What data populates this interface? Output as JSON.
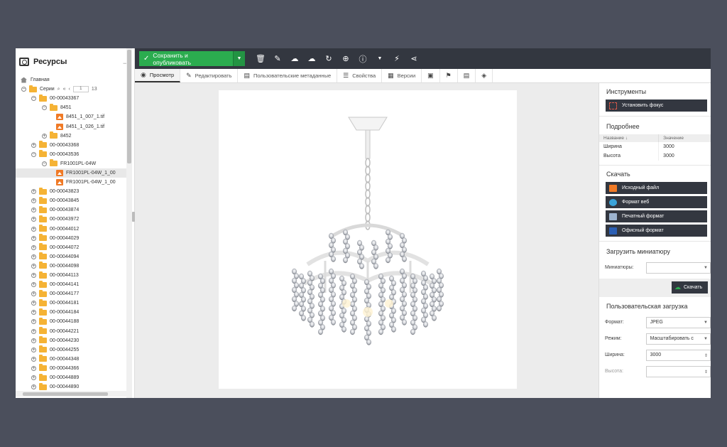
{
  "sidebar": {
    "title": "Ресурсы",
    "home": "Главная",
    "series": "Серии",
    "page_current": "1",
    "page_total": "13",
    "tree": [
      {
        "label": "00-00043367",
        "level": 1,
        "type": "folder",
        "toggle": "−"
      },
      {
        "label": "8451",
        "level": 2,
        "type": "folder",
        "toggle": "−"
      },
      {
        "label": "8451_1_007_1.tif",
        "level": 3,
        "type": "image"
      },
      {
        "label": "8451_1_026_1.tif",
        "level": 3,
        "type": "image"
      },
      {
        "label": "8452",
        "level": 2,
        "type": "folder",
        "toggle": "+"
      },
      {
        "label": "00-00043368",
        "level": 1,
        "type": "folder",
        "toggle": "+"
      },
      {
        "label": "00-00043536",
        "level": 1,
        "type": "folder",
        "toggle": "−"
      },
      {
        "label": "FR1001PL-04W",
        "level": 2,
        "type": "folder",
        "toggle": "−"
      },
      {
        "label": "FR1001PL-04W_1_00",
        "level": 3,
        "type": "image",
        "selected": true
      },
      {
        "label": "FR1001PL-04W_1_00",
        "level": 3,
        "type": "image"
      },
      {
        "label": "00-00043823",
        "level": 1,
        "type": "folder",
        "toggle": "+"
      },
      {
        "label": "00-00043845",
        "level": 1,
        "type": "folder",
        "toggle": "+"
      },
      {
        "label": "00-00043874",
        "level": 1,
        "type": "folder",
        "toggle": "+"
      },
      {
        "label": "00-00043972",
        "level": 1,
        "type": "folder",
        "toggle": "+"
      },
      {
        "label": "00-00044012",
        "level": 1,
        "type": "folder",
        "toggle": "+"
      },
      {
        "label": "00-00044029",
        "level": 1,
        "type": "folder",
        "toggle": "+"
      },
      {
        "label": "00-00044072",
        "level": 1,
        "type": "folder",
        "toggle": "+"
      },
      {
        "label": "00-00044094",
        "level": 1,
        "type": "folder",
        "toggle": "+"
      },
      {
        "label": "00-00044098",
        "level": 1,
        "type": "folder",
        "toggle": "+"
      },
      {
        "label": "00-00044113",
        "level": 1,
        "type": "folder",
        "toggle": "+"
      },
      {
        "label": "00-00044141",
        "level": 1,
        "type": "folder",
        "toggle": "+"
      },
      {
        "label": "00-00044177",
        "level": 1,
        "type": "folder",
        "toggle": "+"
      },
      {
        "label": "00-00044181",
        "level": 1,
        "type": "folder",
        "toggle": "+"
      },
      {
        "label": "00-00044184",
        "level": 1,
        "type": "folder",
        "toggle": "+"
      },
      {
        "label": "00-00044188",
        "level": 1,
        "type": "folder",
        "toggle": "+"
      },
      {
        "label": "00-00044221",
        "level": 1,
        "type": "folder",
        "toggle": "+"
      },
      {
        "label": "00-00044230",
        "level": 1,
        "type": "folder",
        "toggle": "+"
      },
      {
        "label": "00-00044255",
        "level": 1,
        "type": "folder",
        "toggle": "+"
      },
      {
        "label": "00-00044348",
        "level": 1,
        "type": "folder",
        "toggle": "+"
      },
      {
        "label": "00-00044366",
        "level": 1,
        "type": "folder",
        "toggle": "+"
      },
      {
        "label": "00-00044889",
        "level": 1,
        "type": "folder",
        "toggle": "+"
      },
      {
        "label": "00-00044890",
        "level": 1,
        "type": "folder",
        "toggle": "+"
      }
    ]
  },
  "toolbar": {
    "save_label": "Сохранить и опубликовать"
  },
  "tabs": {
    "view": "Просмотр",
    "edit": "Редактировать",
    "metadata": "Пользовательские метаданные",
    "properties": "Свойства",
    "versions": "Версии"
  },
  "panel": {
    "tools_title": "Инструменты",
    "focus_btn": "Установить фокус",
    "details_title": "Подробнее",
    "col_name": "Название",
    "col_value": "Значение",
    "details": [
      {
        "name": "Ширина",
        "value": "3000"
      },
      {
        "name": "Высота",
        "value": "3000"
      }
    ],
    "download_title": "Скачать",
    "downloads": [
      {
        "label": "Исходный файл",
        "icon": "image-file-icon",
        "color": "#f07a26"
      },
      {
        "label": "Формат веб",
        "icon": "globe-icon",
        "color": "#3aa3d9"
      },
      {
        "label": "Печатный формат",
        "icon": "printer-icon",
        "color": "#9db4d0"
      },
      {
        "label": "Офисный формат",
        "icon": "word-icon",
        "color": "#2b5fb4"
      }
    ],
    "thumb_title": "Загрузить миниатюру",
    "thumb_label": "Миниатюры:",
    "thumb_value": "",
    "dl_btn": "Скачать",
    "custom_title": "Пользовательская загрузка",
    "format_label": "Формат:",
    "format_value": "JPEG",
    "mode_label": "Режим:",
    "mode_value": "Масштабировать с",
    "width_label": "Ширина:",
    "width_value": "3000",
    "height_label": "Высота:",
    "height_value": ""
  },
  "colors": {
    "accent": "#2bac4f",
    "toolbar": "#333740",
    "background": "#4b4f5c"
  }
}
